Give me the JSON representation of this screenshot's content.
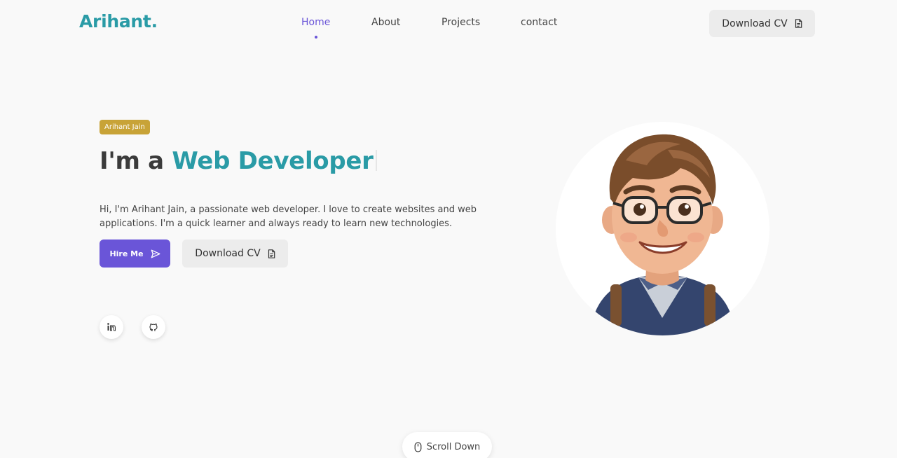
{
  "header": {
    "logo": "Arihant.",
    "nav": [
      {
        "label": "Home",
        "active": true
      },
      {
        "label": "About",
        "active": false
      },
      {
        "label": "Projects",
        "active": false
      },
      {
        "label": "contact",
        "active": false
      }
    ],
    "download_cv": "Download CV",
    "download_icon": "document-icon"
  },
  "hero": {
    "badge": "Arihant Jain",
    "headline_prefix": "I'm a ",
    "headline_accent": "Web Developer",
    "intro": "Hi, I'm Arihant Jain, a passionate web developer. I love to create websites and web applications. I'm a quick learner and always ready to learn new technologies.",
    "hire_label": "Hire Me",
    "hire_icon": "send-icon",
    "download_cv": "Download CV",
    "social": [
      {
        "icon": "linkedin-icon"
      },
      {
        "icon": "github-icon"
      }
    ],
    "avatar_alt": "cartoon-avatar"
  },
  "scroll": {
    "label": "Scroll Down",
    "icon": "mouse-icon"
  },
  "colors": {
    "accent_teal": "#2a9ba6",
    "accent_purple": "#6a55d8",
    "badge_gold": "#c8a337",
    "background": "#f9f9f9"
  }
}
